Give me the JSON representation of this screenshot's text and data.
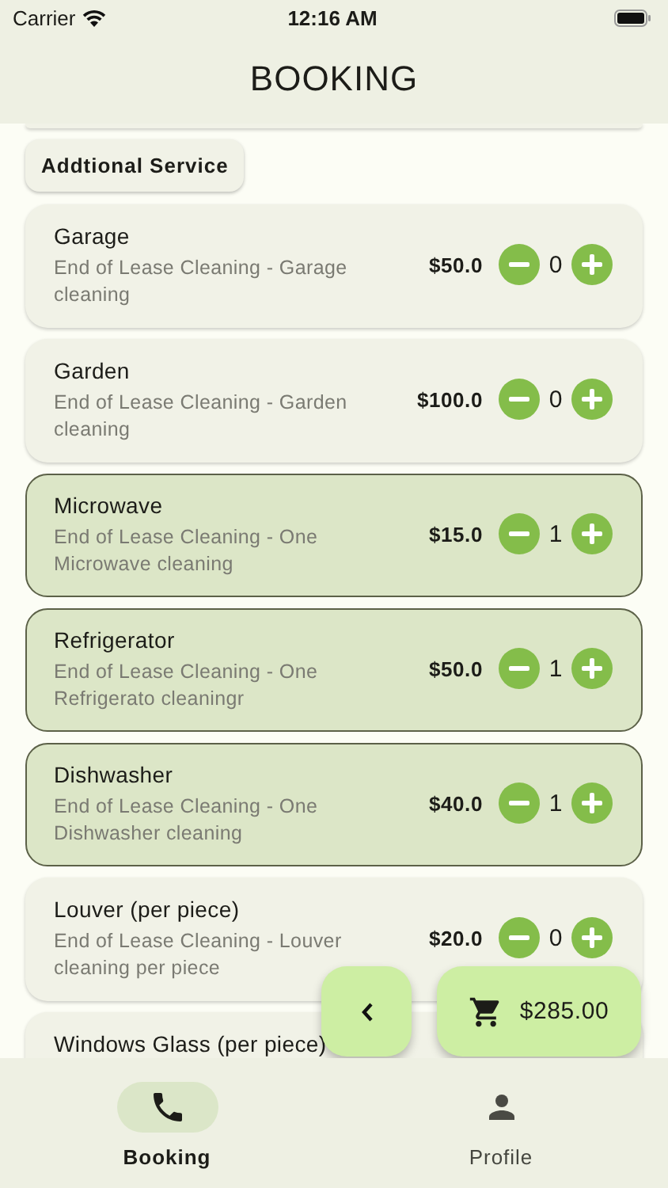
{
  "status_bar": {
    "carrier": "Carrier",
    "time": "12:16 AM"
  },
  "app_bar": {
    "title": "BOOKING"
  },
  "section_chip": "Addtional Service",
  "services": [
    {
      "name": "Garage",
      "description": "End of Lease Cleaning - Garage cleaning",
      "price": "$50.0",
      "quantity": "0",
      "selected": false
    },
    {
      "name": "Garden",
      "description": "End of Lease Cleaning - Garden cleaning",
      "price": "$100.0",
      "quantity": "0",
      "selected": false
    },
    {
      "name": "Microwave",
      "description": "End of Lease Cleaning - One Microwave cleaning",
      "price": "$15.0",
      "quantity": "1",
      "selected": true
    },
    {
      "name": "Refrigerator",
      "description": "End of Lease Cleaning - One Refrigerato cleaningr",
      "price": "$50.0",
      "quantity": "1",
      "selected": true
    },
    {
      "name": "Dishwasher",
      "description": "End of Lease Cleaning - One Dishwasher cleaning",
      "price": "$40.0",
      "quantity": "1",
      "selected": true
    },
    {
      "name": "Louver (per piece)",
      "description": "End of Lease Cleaning - Louver cleaning per piece",
      "price": "$20.0",
      "quantity": "0",
      "selected": false
    },
    {
      "name": "Windows Glass (per piece)",
      "selected": false
    }
  ],
  "cart": {
    "total": "$285.00"
  },
  "nav": [
    {
      "label": "Booking",
      "kind": "phone",
      "selected": true
    },
    {
      "label": "Profile",
      "kind": "person",
      "selected": false
    }
  ]
}
